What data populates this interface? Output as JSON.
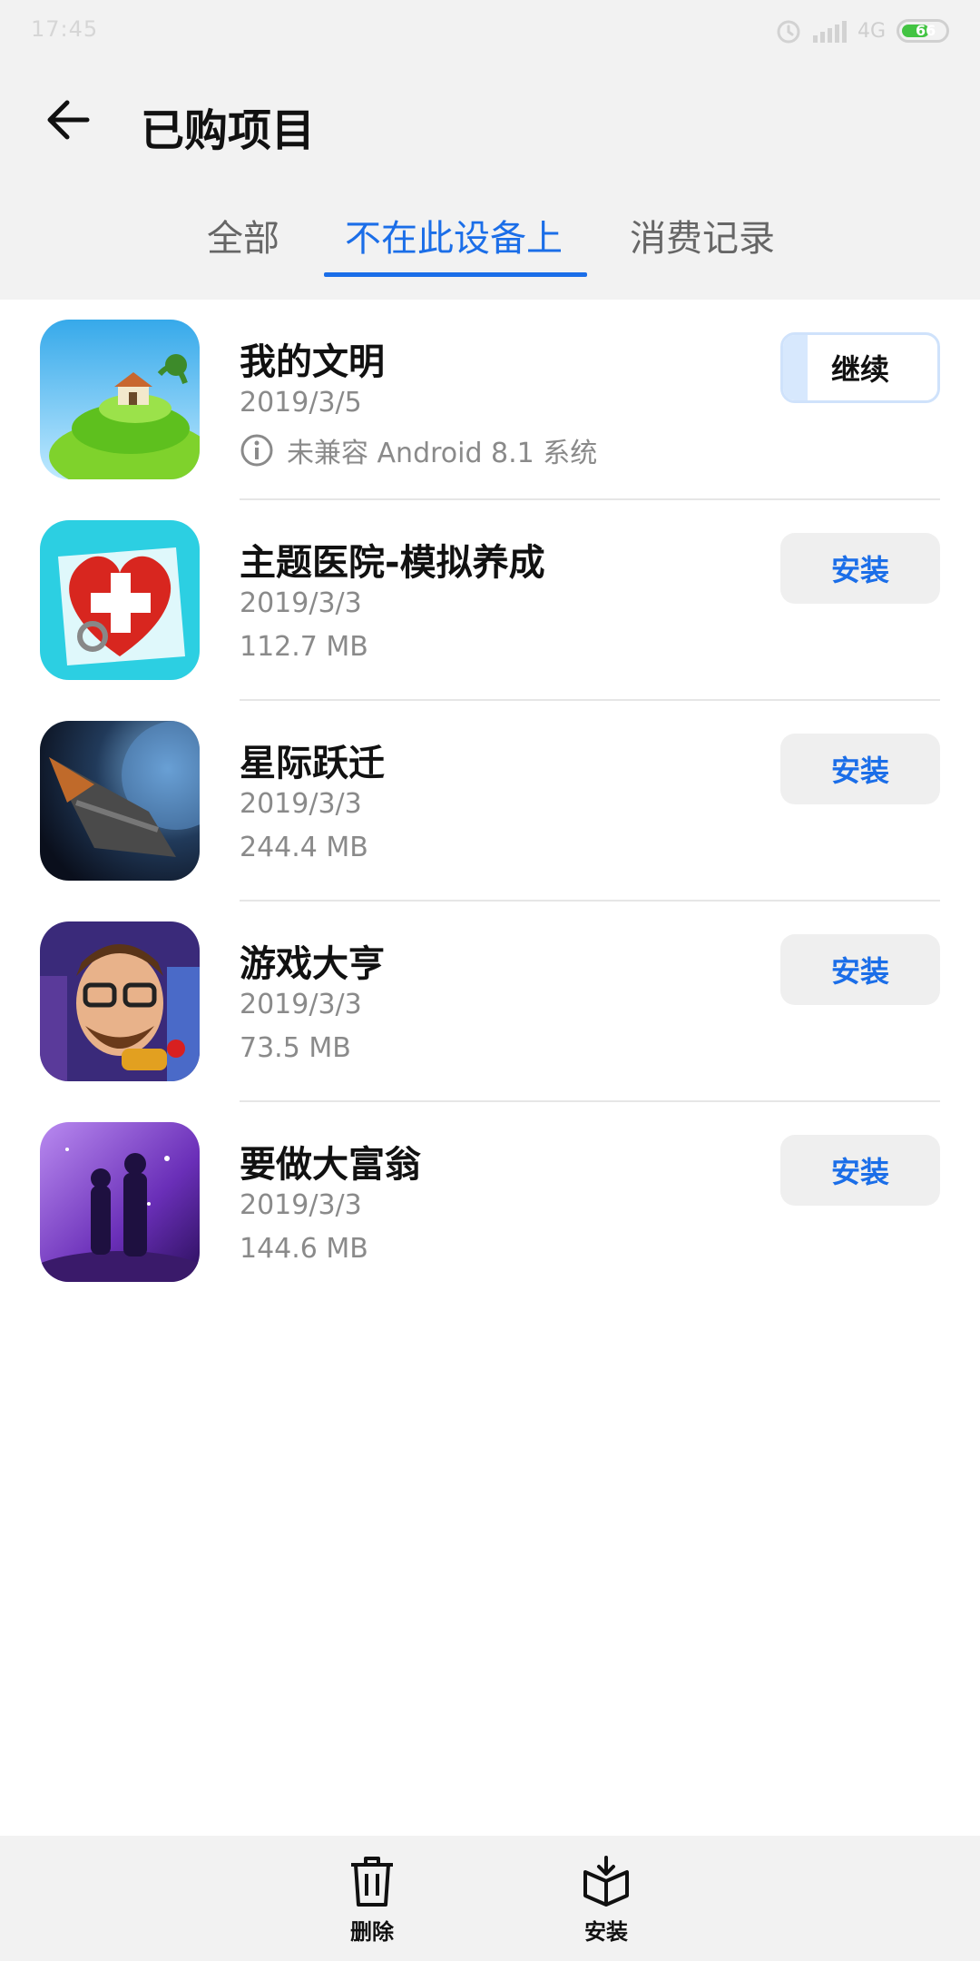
{
  "status_bar": {
    "time": "17:45",
    "network": "4G",
    "battery": "66"
  },
  "header": {
    "title": "已购项目"
  },
  "tabs": [
    {
      "label": "全部"
    },
    {
      "label": "不在此设备上"
    },
    {
      "label": "消费记录"
    }
  ],
  "apps": [
    {
      "name": "我的文明",
      "date": "2019/3/5",
      "meta": "未兼容 Android 8.1 系统",
      "action": "继续",
      "progress": 0.16
    },
    {
      "name": "主题医院-模拟养成",
      "date": "2019/3/3",
      "meta": "112.7 MB",
      "action": "安装"
    },
    {
      "name": "星际跃迁",
      "date": "2019/3/3",
      "meta": "244.4 MB",
      "action": "安装"
    },
    {
      "name": "游戏大亨",
      "date": "2019/3/3",
      "meta": "73.5 MB",
      "action": "安装"
    },
    {
      "name": "要做大富翁",
      "date": "2019/3/3",
      "meta": "144.6 MB",
      "action": "安装"
    }
  ],
  "bottom_bar": {
    "delete_label": "删除",
    "install_label": "安装"
  },
  "colors": {
    "accent": "#1b6ee8",
    "background_top": "#f2f2f2"
  }
}
